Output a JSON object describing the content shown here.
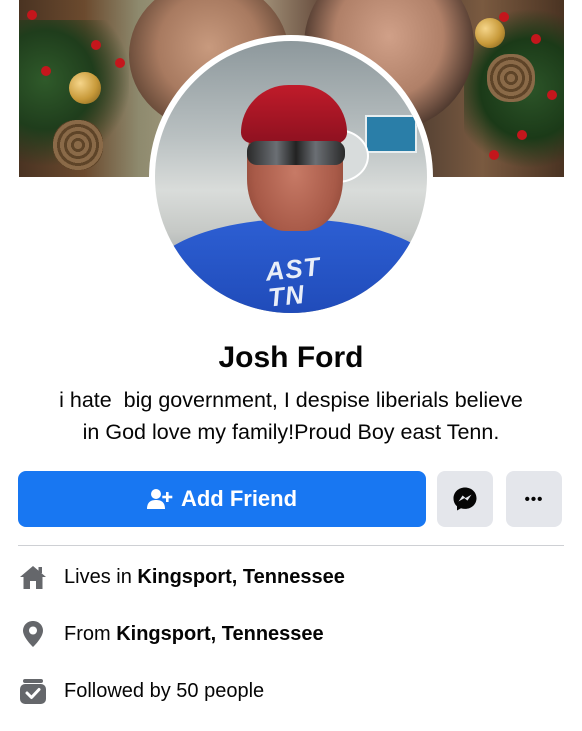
{
  "profile": {
    "name": "Josh Ford",
    "bio_line1": "i hate  big government, I despise liberials believe",
    "bio_line2": "in God love my family!Proud Boy east Tenn.",
    "shirt_text_line1": "AST",
    "shirt_text_line2": "TN"
  },
  "actions": {
    "add_friend_label": "Add Friend",
    "add_friend_icon": "add-person-icon",
    "messenger_icon": "messenger-icon",
    "more_label": "•••"
  },
  "info": {
    "lives_prefix": "Lives in ",
    "lives_value": "Kingsport, Tennessee",
    "from_prefix": "From ",
    "from_value": "Kingsport, Tennessee",
    "followers_text": "Followed by 50 people"
  },
  "colors": {
    "accent": "#1877f2",
    "button_gray": "#e4e6eb",
    "text": "#050505",
    "icon_gray": "#65676b"
  }
}
